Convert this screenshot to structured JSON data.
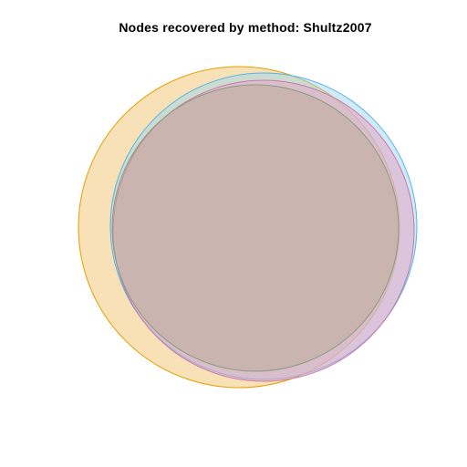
{
  "chart_data": {
    "type": "venn",
    "title": "Nodes recovered by method: Shultz2007",
    "sets": [
      {
        "id": "a",
        "fill": "#F2C46D",
        "stroke": "#E69F00",
        "opacity": 0.5
      },
      {
        "id": "b",
        "fill": "#9ED8EF",
        "stroke": "#56B4E9",
        "opacity": 0.5
      },
      {
        "id": "c",
        "fill": "#E8A0C4",
        "stroke": "#CC79A7",
        "opacity": 0.5
      },
      {
        "id": "d",
        "fill": "#B9A88E",
        "stroke": "#8C9A84",
        "opacity": 0.45
      }
    ]
  }
}
